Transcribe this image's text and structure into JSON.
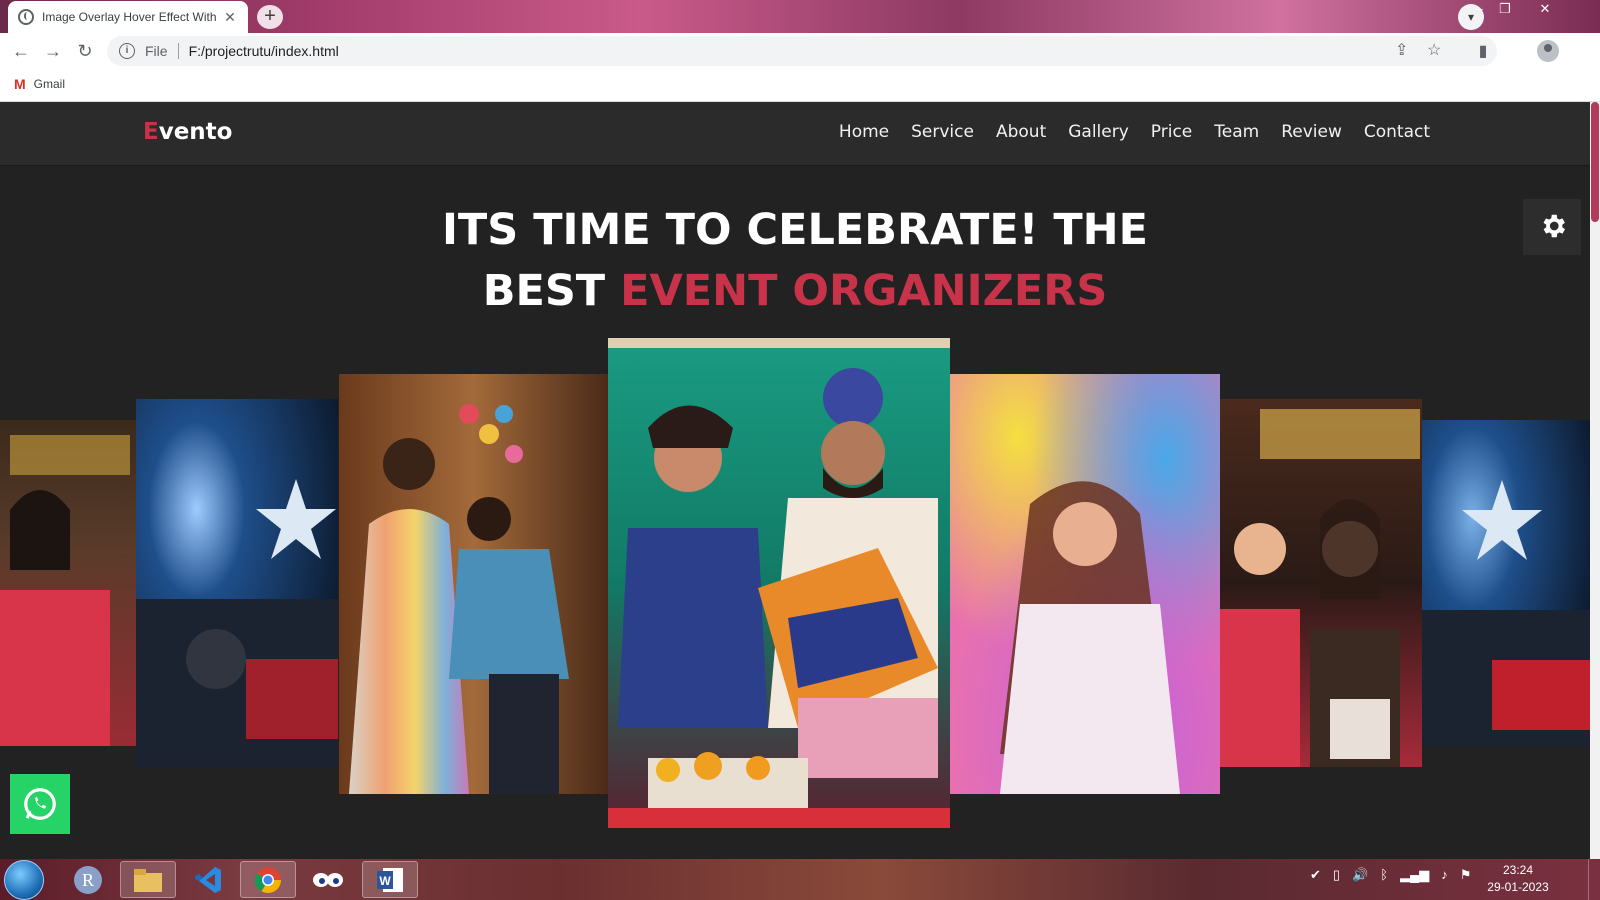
{
  "browser": {
    "tab_title": "Image Overlay Hover Effect With",
    "tab_close": "✕",
    "new_tab": "+",
    "url_scheme": "File",
    "url": "F:/projectrutu/index.html",
    "bookmark_gmail": "Gmail"
  },
  "site": {
    "logo_first": "E",
    "logo_rest": "vento",
    "nav": [
      "Home",
      "Service",
      "About",
      "Gallery",
      "Price",
      "Team",
      "Review",
      "Contact"
    ],
    "hero_line1": "ITS TIME TO CELEBRATE! THE",
    "hero_line2_plain": "BEST ",
    "hero_line2_accent": "EVENT ORGANIZERS",
    "accent_color": "#c8334a"
  },
  "taskbar": {
    "time": "23:24",
    "date": "29-01-2023"
  }
}
